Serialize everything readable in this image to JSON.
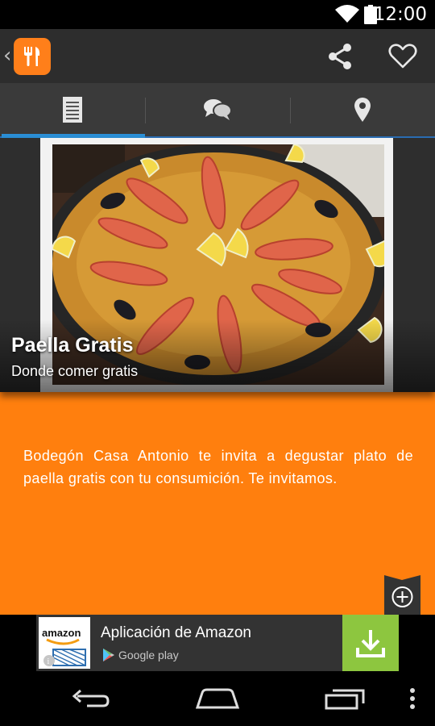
{
  "status_bar": {
    "time": "12:00",
    "icons": [
      "wifi-icon",
      "battery-icon"
    ]
  },
  "action_bar": {
    "back_icon": "chevron-left-icon",
    "app_icon": "fork-knife-icon",
    "actions": [
      "share-icon",
      "heart-icon"
    ]
  },
  "tabs": [
    {
      "icon": "document-icon",
      "active": true
    },
    {
      "icon": "chat-bubbles-icon",
      "active": false
    },
    {
      "icon": "location-pin-icon",
      "active": false
    }
  ],
  "hero": {
    "title": "Paella Gratis",
    "subtitle": "Donde comer gratis"
  },
  "description": "Bodegón Casa Antonio te invita a degustar plato de paella gratis con tu consumición. Te invitamos.",
  "ad": {
    "logo_text": "amazon",
    "title": "Aplicación de Amazon",
    "store": "Google play",
    "action_icon": "download-icon"
  },
  "navigation": [
    "back-icon",
    "home-icon",
    "recents-icon",
    "overflow-menu-icon"
  ],
  "colors": {
    "accent": "#ff7f0e",
    "tab_indicator": "#2b8fd6",
    "action_bar": "#2d2d2d",
    "ad_button": "#8dc63f"
  }
}
